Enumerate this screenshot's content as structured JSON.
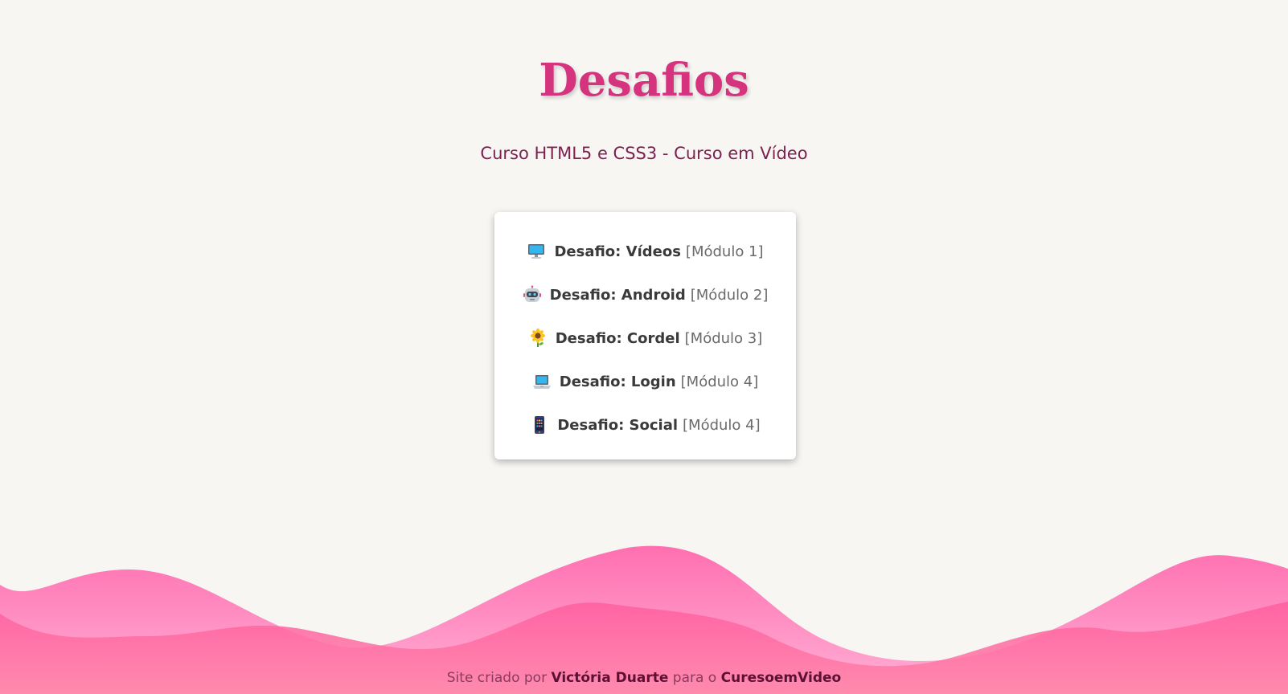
{
  "header": {
    "title": "Desafios",
    "subtitle": "Curso HTML5 e CSS3 - Curso em Vídeo"
  },
  "challenges": [
    {
      "icon": "desktop-computer-icon",
      "label": "Desafio: Vídeos",
      "module": "[Módulo 1]"
    },
    {
      "icon": "robot-icon",
      "label": "Desafio: Android",
      "module": "[Módulo 2]"
    },
    {
      "icon": "sunflower-icon",
      "label": "Desafio: Cordel",
      "module": "[Módulo 3]"
    },
    {
      "icon": "laptop-icon",
      "label": "Desafio: Login",
      "module": "[Módulo 4]"
    },
    {
      "icon": "mobile-phone-icon",
      "label": "Desafio: Social",
      "module": "[Módulo 4]"
    }
  ],
  "footer": {
    "prefix": "Site criado por",
    "author": "Victória Duarte",
    "middle": "para o",
    "site": "CuresoemVideo"
  },
  "colors": {
    "background": "#f8f6f3",
    "title": "#d6337f",
    "subtitle": "#7d1f4f",
    "wave_light": "#fa8fc7",
    "wave_dark": "#ff6fa8"
  }
}
